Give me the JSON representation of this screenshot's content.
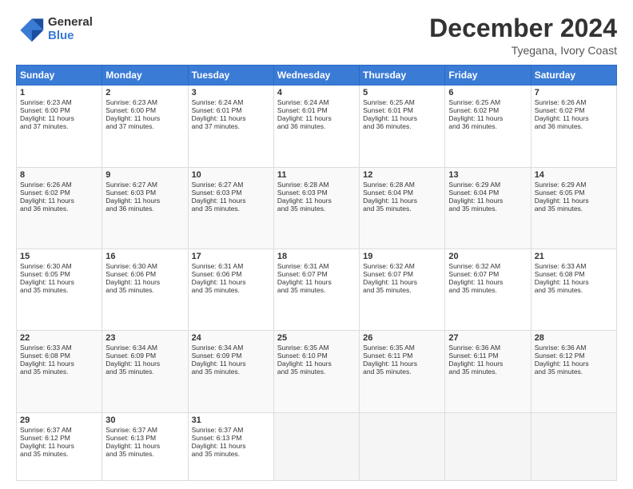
{
  "header": {
    "logo_line1": "General",
    "logo_line2": "Blue",
    "month": "December 2024",
    "location": "Tyegana, Ivory Coast"
  },
  "days_of_week": [
    "Sunday",
    "Monday",
    "Tuesday",
    "Wednesday",
    "Thursday",
    "Friday",
    "Saturday"
  ],
  "weeks": [
    [
      {
        "day": "1",
        "lines": [
          "Sunrise: 6:23 AM",
          "Sunset: 6:00 PM",
          "Daylight: 11 hours",
          "and 37 minutes."
        ]
      },
      {
        "day": "2",
        "lines": [
          "Sunrise: 6:23 AM",
          "Sunset: 6:00 PM",
          "Daylight: 11 hours",
          "and 37 minutes."
        ]
      },
      {
        "day": "3",
        "lines": [
          "Sunrise: 6:24 AM",
          "Sunset: 6:01 PM",
          "Daylight: 11 hours",
          "and 37 minutes."
        ]
      },
      {
        "day": "4",
        "lines": [
          "Sunrise: 6:24 AM",
          "Sunset: 6:01 PM",
          "Daylight: 11 hours",
          "and 36 minutes."
        ]
      },
      {
        "day": "5",
        "lines": [
          "Sunrise: 6:25 AM",
          "Sunset: 6:01 PM",
          "Daylight: 11 hours",
          "and 36 minutes."
        ]
      },
      {
        "day": "6",
        "lines": [
          "Sunrise: 6:25 AM",
          "Sunset: 6:02 PM",
          "Daylight: 11 hours",
          "and 36 minutes."
        ]
      },
      {
        "day": "7",
        "lines": [
          "Sunrise: 6:26 AM",
          "Sunset: 6:02 PM",
          "Daylight: 11 hours",
          "and 36 minutes."
        ]
      }
    ],
    [
      {
        "day": "8",
        "lines": [
          "Sunrise: 6:26 AM",
          "Sunset: 6:02 PM",
          "Daylight: 11 hours",
          "and 36 minutes."
        ]
      },
      {
        "day": "9",
        "lines": [
          "Sunrise: 6:27 AM",
          "Sunset: 6:03 PM",
          "Daylight: 11 hours",
          "and 36 minutes."
        ]
      },
      {
        "day": "10",
        "lines": [
          "Sunrise: 6:27 AM",
          "Sunset: 6:03 PM",
          "Daylight: 11 hours",
          "and 35 minutes."
        ]
      },
      {
        "day": "11",
        "lines": [
          "Sunrise: 6:28 AM",
          "Sunset: 6:03 PM",
          "Daylight: 11 hours",
          "and 35 minutes."
        ]
      },
      {
        "day": "12",
        "lines": [
          "Sunrise: 6:28 AM",
          "Sunset: 6:04 PM",
          "Daylight: 11 hours",
          "and 35 minutes."
        ]
      },
      {
        "day": "13",
        "lines": [
          "Sunrise: 6:29 AM",
          "Sunset: 6:04 PM",
          "Daylight: 11 hours",
          "and 35 minutes."
        ]
      },
      {
        "day": "14",
        "lines": [
          "Sunrise: 6:29 AM",
          "Sunset: 6:05 PM",
          "Daylight: 11 hours",
          "and 35 minutes."
        ]
      }
    ],
    [
      {
        "day": "15",
        "lines": [
          "Sunrise: 6:30 AM",
          "Sunset: 6:05 PM",
          "Daylight: 11 hours",
          "and 35 minutes."
        ]
      },
      {
        "day": "16",
        "lines": [
          "Sunrise: 6:30 AM",
          "Sunset: 6:06 PM",
          "Daylight: 11 hours",
          "and 35 minutes."
        ]
      },
      {
        "day": "17",
        "lines": [
          "Sunrise: 6:31 AM",
          "Sunset: 6:06 PM",
          "Daylight: 11 hours",
          "and 35 minutes."
        ]
      },
      {
        "day": "18",
        "lines": [
          "Sunrise: 6:31 AM",
          "Sunset: 6:07 PM",
          "Daylight: 11 hours",
          "and 35 minutes."
        ]
      },
      {
        "day": "19",
        "lines": [
          "Sunrise: 6:32 AM",
          "Sunset: 6:07 PM",
          "Daylight: 11 hours",
          "and 35 minutes."
        ]
      },
      {
        "day": "20",
        "lines": [
          "Sunrise: 6:32 AM",
          "Sunset: 6:07 PM",
          "Daylight: 11 hours",
          "and 35 minutes."
        ]
      },
      {
        "day": "21",
        "lines": [
          "Sunrise: 6:33 AM",
          "Sunset: 6:08 PM",
          "Daylight: 11 hours",
          "and 35 minutes."
        ]
      }
    ],
    [
      {
        "day": "22",
        "lines": [
          "Sunrise: 6:33 AM",
          "Sunset: 6:08 PM",
          "Daylight: 11 hours",
          "and 35 minutes."
        ]
      },
      {
        "day": "23",
        "lines": [
          "Sunrise: 6:34 AM",
          "Sunset: 6:09 PM",
          "Daylight: 11 hours",
          "and 35 minutes."
        ]
      },
      {
        "day": "24",
        "lines": [
          "Sunrise: 6:34 AM",
          "Sunset: 6:09 PM",
          "Daylight: 11 hours",
          "and 35 minutes."
        ]
      },
      {
        "day": "25",
        "lines": [
          "Sunrise: 6:35 AM",
          "Sunset: 6:10 PM",
          "Daylight: 11 hours",
          "and 35 minutes."
        ]
      },
      {
        "day": "26",
        "lines": [
          "Sunrise: 6:35 AM",
          "Sunset: 6:11 PM",
          "Daylight: 11 hours",
          "and 35 minutes."
        ]
      },
      {
        "day": "27",
        "lines": [
          "Sunrise: 6:36 AM",
          "Sunset: 6:11 PM",
          "Daylight: 11 hours",
          "and 35 minutes."
        ]
      },
      {
        "day": "28",
        "lines": [
          "Sunrise: 6:36 AM",
          "Sunset: 6:12 PM",
          "Daylight: 11 hours",
          "and 35 minutes."
        ]
      }
    ],
    [
      {
        "day": "29",
        "lines": [
          "Sunrise: 6:37 AM",
          "Sunset: 6:12 PM",
          "Daylight: 11 hours",
          "and 35 minutes."
        ]
      },
      {
        "day": "30",
        "lines": [
          "Sunrise: 6:37 AM",
          "Sunset: 6:13 PM",
          "Daylight: 11 hours",
          "and 35 minutes."
        ]
      },
      {
        "day": "31",
        "lines": [
          "Sunrise: 6:37 AM",
          "Sunset: 6:13 PM",
          "Daylight: 11 hours",
          "and 35 minutes."
        ]
      },
      null,
      null,
      null,
      null
    ]
  ]
}
